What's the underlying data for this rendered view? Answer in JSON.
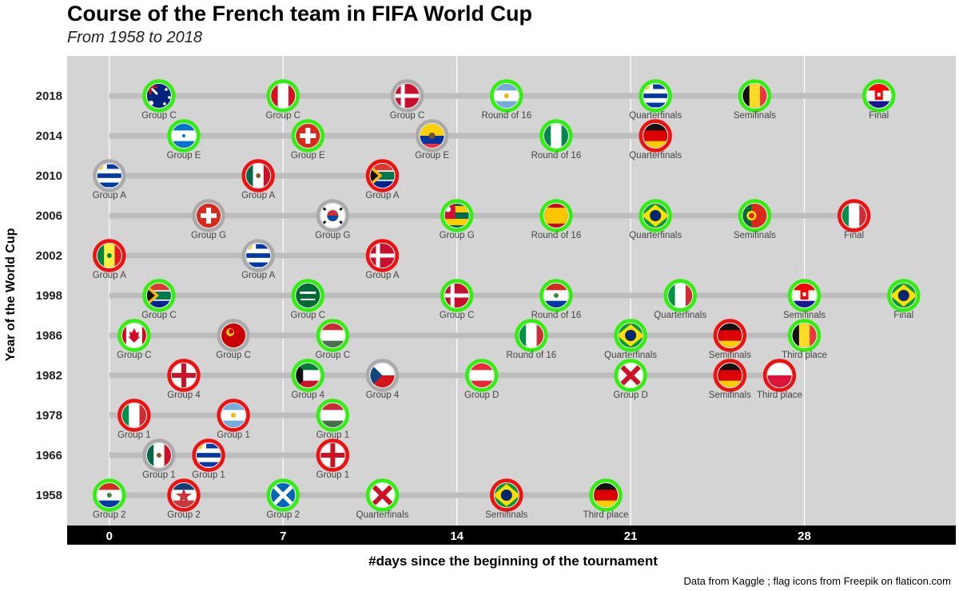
{
  "title": "Course of the French team in FIFA World Cup",
  "subtitle": "From 1958 to 2018",
  "caption": "Data from Kaggle ; flag icons from Freepik on flaticon.com",
  "colors": {
    "won": "#33ee11",
    "lost": "#ee1111",
    "draw": "#aaaaaa",
    "panel": "#d4d4d4",
    "track": "#bdbdbd",
    "grid": "#ffffff",
    "axis_bar": "#000000"
  },
  "chart_data": {
    "type": "scatter",
    "title": "Course of the French team in FIFA World Cup",
    "subtitle": "From 1958 to 2018",
    "xlabel": "#days since the beginning of the tournament",
    "ylabel": "Year of the World Cup",
    "x_ticks": [
      0,
      7,
      14,
      21,
      28
    ],
    "xlim": [
      -1.7,
      34.1
    ],
    "years": [
      "1958",
      "1966",
      "1978",
      "1982",
      "1986",
      "1998",
      "2002",
      "2006",
      "2010",
      "2014",
      "2018"
    ],
    "result_legend": {
      "green": "win",
      "red": "loss",
      "grey": "draw"
    },
    "series": [
      {
        "year": "2018",
        "matches": [
          {
            "day": 2,
            "opponent": "Australia",
            "stage": "Group C",
            "result": "win"
          },
          {
            "day": 7,
            "opponent": "Peru",
            "stage": "Group C",
            "result": "win"
          },
          {
            "day": 12,
            "opponent": "Denmark",
            "stage": "Group C",
            "result": "draw"
          },
          {
            "day": 16,
            "opponent": "Argentina",
            "stage": "Round of 16",
            "result": "win"
          },
          {
            "day": 22,
            "opponent": "Uruguay",
            "stage": "Quarterfinals",
            "result": "win"
          },
          {
            "day": 26,
            "opponent": "Belgium",
            "stage": "Semifinals",
            "result": "win"
          },
          {
            "day": 31,
            "opponent": "Croatia",
            "stage": "Final",
            "result": "win"
          }
        ]
      },
      {
        "year": "2014",
        "matches": [
          {
            "day": 3,
            "opponent": "Honduras",
            "stage": "Group E",
            "result": "win"
          },
          {
            "day": 8,
            "opponent": "Switzerland",
            "stage": "Group E",
            "result": "win"
          },
          {
            "day": 13,
            "opponent": "Ecuador",
            "stage": "Group E",
            "result": "draw"
          },
          {
            "day": 18,
            "opponent": "Nigeria",
            "stage": "Round of 16",
            "result": "win"
          },
          {
            "day": 22,
            "opponent": "Germany",
            "stage": "Quarterfinals",
            "result": "loss"
          }
        ]
      },
      {
        "year": "2010",
        "matches": [
          {
            "day": 0,
            "opponent": "Uruguay",
            "stage": "Group A",
            "result": "draw"
          },
          {
            "day": 6,
            "opponent": "Mexico",
            "stage": "Group A",
            "result": "loss"
          },
          {
            "day": 11,
            "opponent": "South Africa",
            "stage": "Group A",
            "result": "loss"
          }
        ]
      },
      {
        "year": "2006",
        "matches": [
          {
            "day": 4,
            "opponent": "Switzerland",
            "stage": "Group G",
            "result": "draw"
          },
          {
            "day": 9,
            "opponent": "South Korea",
            "stage": "Group G",
            "result": "draw"
          },
          {
            "day": 14,
            "opponent": "Togo",
            "stage": "Group G",
            "result": "win"
          },
          {
            "day": 18,
            "opponent": "Spain",
            "stage": "Round of 16",
            "result": "win"
          },
          {
            "day": 22,
            "opponent": "Brazil",
            "stage": "Quarterfinals",
            "result": "win"
          },
          {
            "day": 26,
            "opponent": "Portugal",
            "stage": "Semifinals",
            "result": "win"
          },
          {
            "day": 30,
            "opponent": "Italy",
            "stage": "Final",
            "result": "loss"
          }
        ]
      },
      {
        "year": "2002",
        "matches": [
          {
            "day": 0,
            "opponent": "Senegal",
            "stage": "Group A",
            "result": "loss"
          },
          {
            "day": 6,
            "opponent": "Uruguay",
            "stage": "Group A",
            "result": "draw"
          },
          {
            "day": 11,
            "opponent": "Denmark",
            "stage": "Group A",
            "result": "loss"
          }
        ]
      },
      {
        "year": "1998",
        "matches": [
          {
            "day": 2,
            "opponent": "South Africa",
            "stage": "Group C",
            "result": "win"
          },
          {
            "day": 8,
            "opponent": "Saudi Arabia",
            "stage": "Group C",
            "result": "win"
          },
          {
            "day": 14,
            "opponent": "Denmark",
            "stage": "Group C",
            "result": "win"
          },
          {
            "day": 18,
            "opponent": "Paraguay",
            "stage": "Round of 16",
            "result": "win"
          },
          {
            "day": 23,
            "opponent": "Italy",
            "stage": "Quarterfinals",
            "result": "win"
          },
          {
            "day": 28,
            "opponent": "Croatia",
            "stage": "Semifinals",
            "result": "win"
          },
          {
            "day": 32,
            "opponent": "Brazil",
            "stage": "Final",
            "result": "win"
          }
        ]
      },
      {
        "year": "1986",
        "matches": [
          {
            "day": 1,
            "opponent": "Canada",
            "stage": "Group C",
            "result": "win"
          },
          {
            "day": 5,
            "opponent": "Soviet Union",
            "stage": "Group C",
            "result": "draw"
          },
          {
            "day": 9,
            "opponent": "Hungary",
            "stage": "Group C",
            "result": "win"
          },
          {
            "day": 17,
            "opponent": "Italy",
            "stage": "Round of 16",
            "result": "win"
          },
          {
            "day": 21,
            "opponent": "Brazil",
            "stage": "Quarterfinals",
            "result": "win"
          },
          {
            "day": 25,
            "opponent": "West Germany",
            "stage": "Semifinals",
            "result": "loss"
          },
          {
            "day": 28,
            "opponent": "Belgium",
            "stage": "Third place",
            "result": "win"
          }
        ]
      },
      {
        "year": "1982",
        "matches": [
          {
            "day": 3,
            "opponent": "England",
            "stage": "Group 4",
            "result": "loss"
          },
          {
            "day": 8,
            "opponent": "Kuwait",
            "stage": "Group 4",
            "result": "win"
          },
          {
            "day": 11,
            "opponent": "Czechoslovakia",
            "stage": "Group 4",
            "result": "draw"
          },
          {
            "day": 15,
            "opponent": "Austria",
            "stage": "Group D",
            "result": "win"
          },
          {
            "day": 21,
            "opponent": "Northern Ireland",
            "stage": "Group D",
            "result": "win"
          },
          {
            "day": 25,
            "opponent": "West Germany",
            "stage": "Semifinals",
            "result": "loss"
          },
          {
            "day": 27,
            "opponent": "Poland",
            "stage": "Third place",
            "result": "loss"
          }
        ]
      },
      {
        "year": "1978",
        "matches": [
          {
            "day": 1,
            "opponent": "Italy",
            "stage": "Group 1",
            "result": "loss"
          },
          {
            "day": 5,
            "opponent": "Argentina",
            "stage": "Group 1",
            "result": "loss"
          },
          {
            "day": 9,
            "opponent": "Hungary",
            "stage": "Group 1",
            "result": "win"
          }
        ]
      },
      {
        "year": "1966",
        "matches": [
          {
            "day": 2,
            "opponent": "Mexico",
            "stage": "Group 1",
            "result": "draw"
          },
          {
            "day": 4,
            "opponent": "Uruguay",
            "stage": "Group 1",
            "result": "loss"
          },
          {
            "day": 9,
            "opponent": "England",
            "stage": "Group 1",
            "result": "loss"
          }
        ]
      },
      {
        "year": "1958",
        "matches": [
          {
            "day": 0,
            "opponent": "Paraguay",
            "stage": "Group 2",
            "result": "win"
          },
          {
            "day": 3,
            "opponent": "Yugoslavia",
            "stage": "Group 2",
            "result": "loss"
          },
          {
            "day": 7,
            "opponent": "Scotland",
            "stage": "Group 2",
            "result": "win"
          },
          {
            "day": 11,
            "opponent": "Northern Ireland",
            "stage": "Quarterfinals",
            "result": "win"
          },
          {
            "day": 16,
            "opponent": "Brazil",
            "stage": "Semifinals",
            "result": "loss"
          },
          {
            "day": 20,
            "opponent": "West Germany",
            "stage": "Third place",
            "result": "win"
          }
        ]
      }
    ]
  }
}
